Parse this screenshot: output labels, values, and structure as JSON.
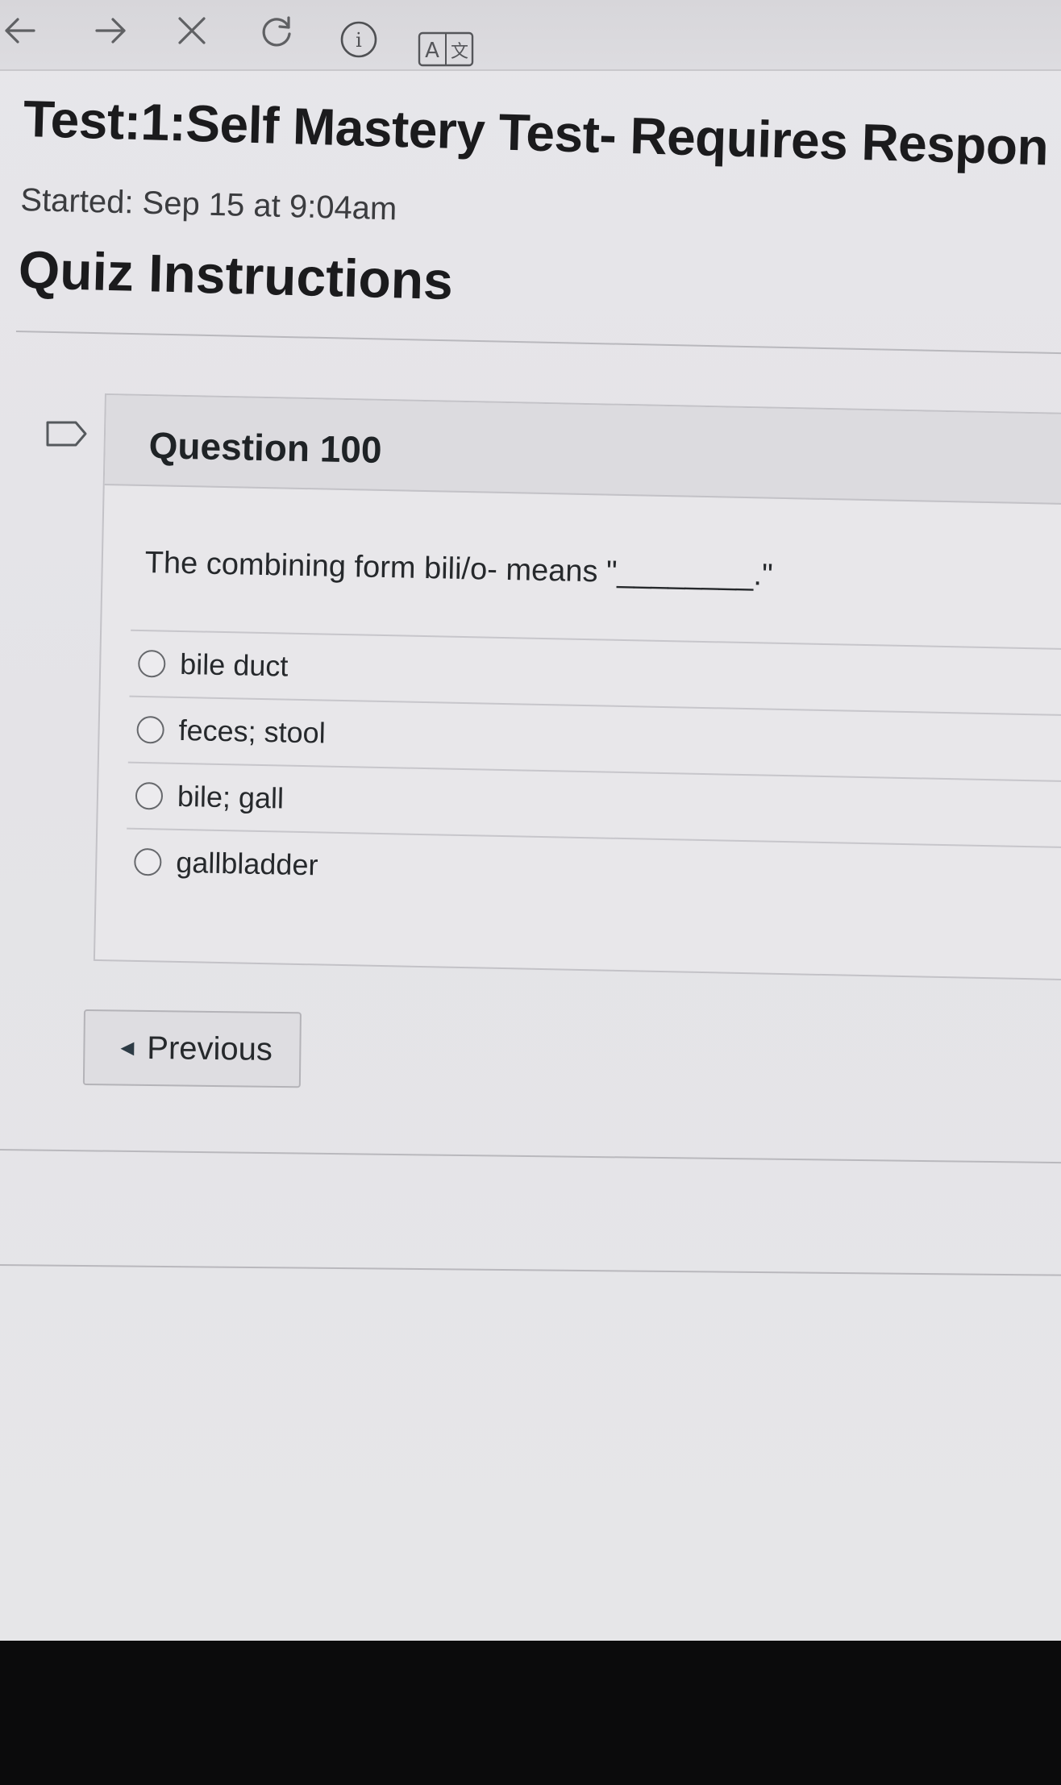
{
  "browser": {
    "back_icon": "arrow-left-icon",
    "forward_icon": "arrow-right-icon",
    "stop_icon": "close-icon",
    "reload_icon": "reload-icon",
    "info_icon": "info-icon",
    "translate_icon": "translate-icon",
    "info_glyph": "i",
    "translate_glyph_a": "A",
    "translate_glyph_b": "文"
  },
  "page": {
    "title": "Test:1:Self Mastery Test- Requires Respon",
    "started": "Started: Sep 15 at 9:04am",
    "instructions_heading": "Quiz Instructions"
  },
  "question": {
    "flag_icon": "flag-icon",
    "title": "Question 100",
    "text": "The combining form bili/o- means \"________.\"",
    "answers": [
      {
        "label": "bile duct",
        "selected": false
      },
      {
        "label": "feces; stool",
        "selected": false
      },
      {
        "label": "bile; gall",
        "selected": false
      },
      {
        "label": "gallbladder",
        "selected": false
      }
    ]
  },
  "nav": {
    "previous_label": "Previous",
    "previous_icon": "caret-left-icon"
  }
}
